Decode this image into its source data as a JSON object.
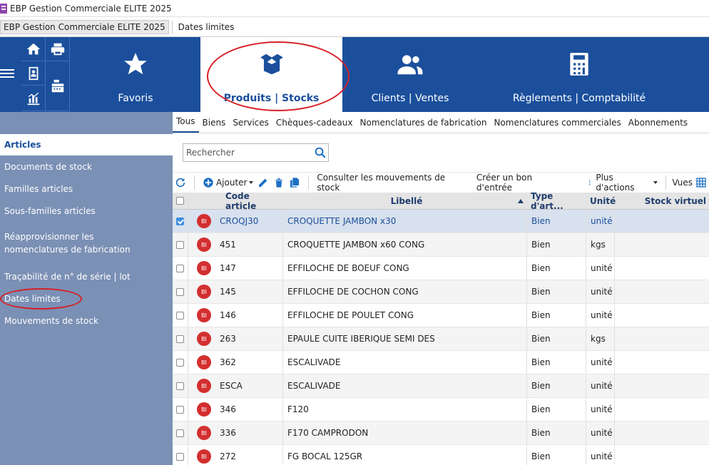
{
  "window": {
    "title": "EBP Gestion Commerciale ELITE 2025"
  },
  "tabs": [
    {
      "label": "EBP Gestion Commerciale ELITE 2025"
    },
    {
      "label": "Dates limites"
    }
  ],
  "ribbon": {
    "modules": [
      {
        "label": "Favoris",
        "icon": "star-icon"
      },
      {
        "label": "Produits | Stocks",
        "icon": "box-icon"
      },
      {
        "label": "Clients | Ventes",
        "icon": "users-icon"
      },
      {
        "label": "Règlements | Comptabilité",
        "icon": "calculator-icon"
      }
    ]
  },
  "sidebar": {
    "items": [
      {
        "label": "Articles"
      },
      {
        "label": "Documents de stock"
      },
      {
        "label": "Familles articles"
      },
      {
        "label": "Sous-familles articles"
      },
      {
        "label": "Réapprovisionner les nomenclatures de fabrication"
      },
      {
        "label": "Traçabilité de n° de série | lot"
      },
      {
        "label": "Dates limites"
      },
      {
        "label": "Mouvements de stock"
      }
    ]
  },
  "subtabs": [
    "Tous",
    "Biens",
    "Services",
    "Chèques-cadeaux",
    "Nomenclatures de fabrication",
    "Nomenclatures commerciales",
    "Abonnements"
  ],
  "search": {
    "placeholder": "Rechercher"
  },
  "toolbar": {
    "add_label": "Ajouter",
    "consult_label": "Consulter les mouvements de stock",
    "create_label": "Créer un bon d'entrée",
    "more_label": "Plus d'actions",
    "views_label": "Vues"
  },
  "grid": {
    "headers": {
      "code": "Code article",
      "label": "Libellé",
      "type": "Type d'art...",
      "unit": "Unité",
      "stock": "Stock virtuel"
    },
    "badge": "BI",
    "rows": [
      {
        "code": "CROQJ30",
        "label": "CROQUETTE JAMBON x30",
        "type": "Bien",
        "unit": "unité",
        "checked": true
      },
      {
        "code": "451",
        "label": "CROQUETTE JAMBON x60 CONG",
        "type": "Bien",
        "unit": "kgs"
      },
      {
        "code": "147",
        "label": "EFFILOCHE DE BOEUF CONG",
        "type": "Bien",
        "unit": "unité"
      },
      {
        "code": "145",
        "label": "EFFILOCHE DE COCHON CONG",
        "type": "Bien",
        "unit": "unité"
      },
      {
        "code": "146",
        "label": "EFFILOCHE DE POULET CONG",
        "type": "Bien",
        "unit": "unité"
      },
      {
        "code": "263",
        "label": "EPAULE CUITE IBERIQUE SEMI DES",
        "type": "Bien",
        "unit": "kgs"
      },
      {
        "code": "362",
        "label": "ESCALIVADE",
        "type": "Bien",
        "unit": "unité"
      },
      {
        "code": "ESCA",
        "label": "ESCALIVADE",
        "type": "Bien",
        "unit": "unité"
      },
      {
        "code": "346",
        "label": "F120",
        "type": "Bien",
        "unit": "unité"
      },
      {
        "code": "336",
        "label": "F170 CAMPRODON",
        "type": "Bien",
        "unit": "unité"
      },
      {
        "code": "272",
        "label": "FG BOCAL 125GR",
        "type": "Bien",
        "unit": "unité"
      }
    ]
  },
  "colors": {
    "ribbon": "#1b4f9c",
    "sidebar": "#7b90b5",
    "highlight": "#d61f26"
  }
}
